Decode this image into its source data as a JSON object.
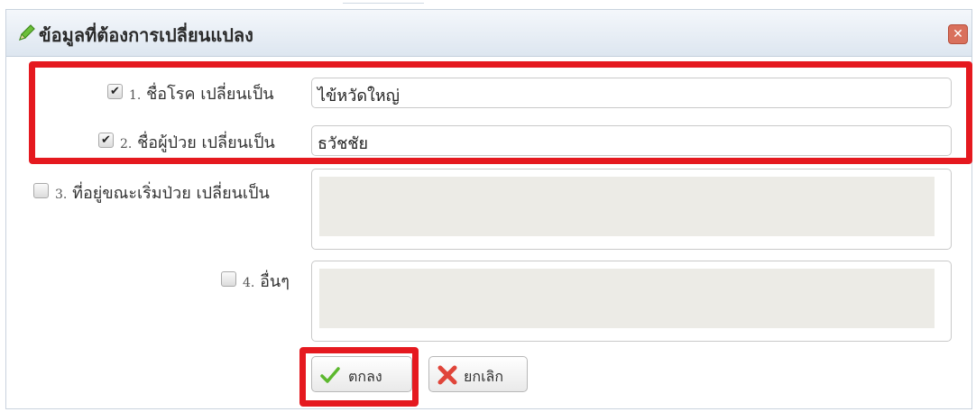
{
  "dialog": {
    "title": "ข้อมูลที่ต้องการเปลี่ยนแปลง",
    "close_glyph": "✕"
  },
  "fields": [
    {
      "number": "1.",
      "label": "ชื่อโรค เปลี่ยนเป็น",
      "checked": true,
      "value": "ไข้หวัดใหญ่"
    },
    {
      "number": "2.",
      "label": "ชื่อผู้ป่วย เปลี่ยนเป็น",
      "checked": true,
      "value": "ธวัชชัย"
    },
    {
      "number": "3.",
      "label": "ที่อยู่ขณะเริ่มป่วย เปลี่ยนเป็น",
      "checked": false,
      "value": ""
    },
    {
      "number": "4.",
      "label": "อื่นๆ",
      "checked": false,
      "value": ""
    }
  ],
  "buttons": {
    "ok_label": "ตกลง",
    "cancel_label": "ยกเลิก"
  },
  "colors": {
    "highlight": "#e5191f",
    "ok_check": "#5cb82e",
    "cancel_x": "#e0453a"
  }
}
